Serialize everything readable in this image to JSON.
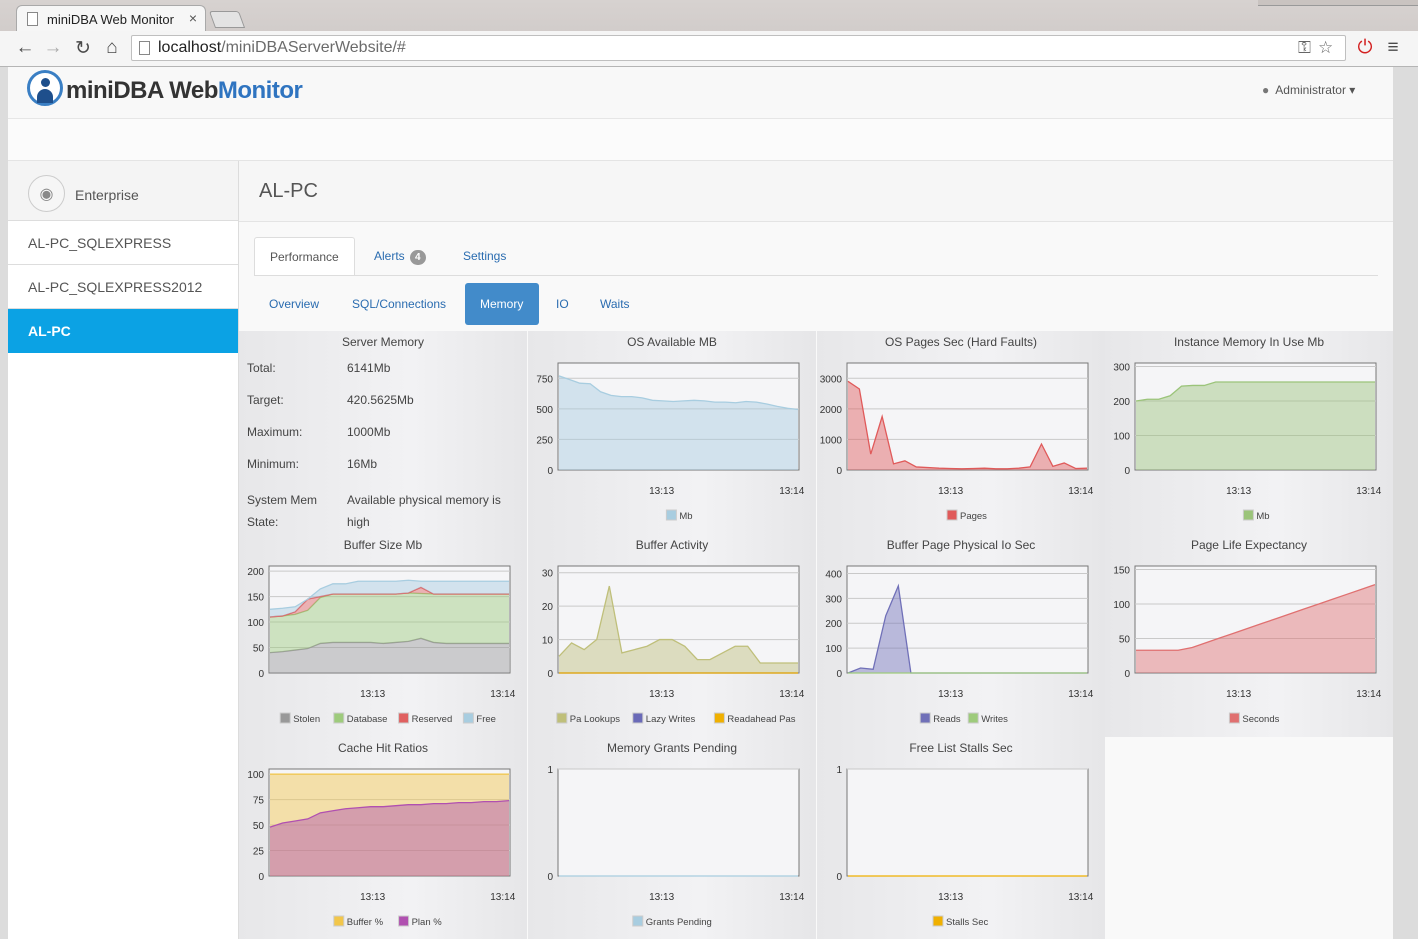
{
  "browser": {
    "tab_title": "miniDBA Web Monitor",
    "url_host": "localhost",
    "url_path": "/miniDBAServerWebsite/#"
  },
  "app": {
    "logo_mini": "mini",
    "logo_dba": "DBA ",
    "logo_web": "Web",
    "logo_monitor": "Monitor",
    "user_menu": "Administrator"
  },
  "sidebar": {
    "group": "Enterprise",
    "items": [
      {
        "label": "AL-PC_SQLEXPRESS",
        "active": false
      },
      {
        "label": "AL-PC_SQLEXPRESS2012",
        "active": false
      },
      {
        "label": "AL-PC",
        "active": true
      }
    ]
  },
  "page": {
    "title": "AL-PC",
    "tabs": [
      {
        "label": "Performance",
        "active": true
      },
      {
        "label": "Alerts",
        "badge": "4",
        "active": false
      },
      {
        "label": "Settings",
        "active": false
      }
    ],
    "subtabs": [
      {
        "label": "Overview",
        "active": false
      },
      {
        "label": "SQL/Connections",
        "active": false
      },
      {
        "label": "Memory",
        "active": true
      },
      {
        "label": "IO",
        "active": false
      },
      {
        "label": "Waits",
        "active": false
      }
    ]
  },
  "server_memory": {
    "title": "Server Memory",
    "rows": [
      {
        "label": "Total:",
        "value": "6141Mb"
      },
      {
        "label": "Target:",
        "value": "420.5625Mb"
      },
      {
        "label": "Maximum:",
        "value": "1000Mb"
      },
      {
        "label": "Minimum:",
        "value": "16Mb"
      },
      {
        "label": "System Mem State:",
        "value": "Available physical memory is high"
      }
    ]
  },
  "chart_data": [
    {
      "id": "os-available-mb",
      "type": "area",
      "title": "OS Available MB",
      "ylim": [
        0,
        875
      ],
      "yticks": [
        0,
        250,
        500,
        750
      ],
      "xticks": [
        "13:13",
        "13:14"
      ],
      "series": [
        {
          "name": "Mb",
          "color": "#a8cde0",
          "values": [
            770,
            740,
            710,
            705,
            640,
            610,
            600,
            600,
            590,
            570,
            565,
            560,
            565,
            570,
            565,
            555,
            555,
            550,
            560,
            555,
            540,
            520,
            505,
            495
          ]
        }
      ]
    },
    {
      "id": "os-pages-sec",
      "type": "area",
      "title": "OS Pages Sec (Hard Faults)",
      "ylim": [
        0,
        3500
      ],
      "yticks": [
        0,
        1000,
        2000,
        3000
      ],
      "xticks": [
        "13:13",
        "13:14"
      ],
      "series": [
        {
          "name": "Pages",
          "color": "#e05a5a",
          "values": [
            2900,
            2650,
            520,
            1750,
            200,
            300,
            100,
            80,
            60,
            50,
            40,
            50,
            60,
            40,
            40,
            60,
            100,
            850,
            120,
            230,
            50,
            60
          ]
        }
      ]
    },
    {
      "id": "instance-memory",
      "type": "area",
      "title": "Instance Memory In Use Mb",
      "ylim": [
        0,
        310
      ],
      "yticks": [
        0,
        100,
        200,
        300
      ],
      "xticks": [
        "13:13",
        "13:14"
      ],
      "series": [
        {
          "name": "Mb",
          "color": "#9bc47a",
          "values": [
            200,
            205,
            205,
            215,
            243,
            245,
            245,
            255,
            255,
            255,
            255,
            255,
            255,
            255,
            255,
            255,
            255,
            255,
            255,
            255,
            255,
            255
          ]
        }
      ]
    },
    {
      "id": "buffer-size",
      "type": "stacked-area",
      "title": "Buffer Size Mb",
      "ylim": [
        0,
        210
      ],
      "yticks": [
        0,
        50,
        100,
        150,
        200
      ],
      "xticks": [
        "13:13",
        "13:14"
      ],
      "series": [
        {
          "name": "Stolen",
          "color": "#999999",
          "values": [
            40,
            42,
            45,
            48,
            58,
            60,
            60,
            60,
            60,
            58,
            60,
            62,
            68,
            60,
            58,
            58,
            58,
            58,
            58,
            58
          ]
        },
        {
          "name": "Database",
          "color": "#9ecb7c",
          "values": [
            70,
            70,
            70,
            75,
            90,
            95,
            95,
            95,
            95,
            97,
            95,
            95,
            88,
            95,
            97,
            97,
            97,
            97,
            97,
            97
          ]
        },
        {
          "name": "Reserved",
          "color": "#e06060",
          "values": [
            0,
            0,
            5,
            22,
            2,
            0,
            0,
            0,
            0,
            0,
            0,
            0,
            12,
            0,
            0,
            0,
            0,
            0,
            0,
            0
          ]
        },
        {
          "name": "Free",
          "color": "#a8cde0",
          "values": [
            15,
            15,
            10,
            0,
            15,
            20,
            20,
            25,
            25,
            25,
            25,
            25,
            12,
            25,
            25,
            25,
            25,
            25,
            25,
            25
          ]
        }
      ]
    },
    {
      "id": "buffer-activity",
      "type": "area",
      "title": "Buffer Activity",
      "ylim": [
        0,
        32
      ],
      "yticks": [
        0,
        10,
        20,
        30
      ],
      "xticks": [
        "13:13",
        "13:14"
      ],
      "series": [
        {
          "name": "Pa Lookups",
          "color": "#bfbf7a",
          "values": [
            5,
            9,
            7,
            10,
            26,
            6,
            7,
            8,
            10,
            10,
            8,
            4,
            4,
            6,
            8,
            8,
            3,
            3,
            3,
            3
          ]
        },
        {
          "name": "Lazy Writes",
          "color": "#6a6ab8",
          "values": [
            0,
            0,
            0,
            0,
            0,
            0,
            0,
            0,
            0,
            0,
            0,
            0,
            0,
            0,
            0,
            0,
            0,
            0,
            0,
            0
          ]
        },
        {
          "name": "Readahead Pas",
          "color": "#f0b000",
          "values": [
            0,
            0,
            0,
            0,
            0,
            0,
            0,
            0,
            0,
            0,
            0,
            0,
            0,
            0,
            0,
            0,
            0,
            0,
            0,
            0
          ]
        }
      ]
    },
    {
      "id": "buffer-page-io",
      "type": "area",
      "title": "Buffer Page Physical Io Sec",
      "ylim": [
        0,
        430
      ],
      "yticks": [
        0,
        100,
        200,
        300,
        400
      ],
      "xticks": [
        "13:13",
        "13:14"
      ],
      "series": [
        {
          "name": "Reads",
          "color": "#7070b8",
          "values": [
            0,
            20,
            15,
            230,
            350,
            0,
            0,
            0,
            0,
            0,
            0,
            0,
            0,
            0,
            0,
            0,
            0,
            0,
            0,
            0
          ]
        },
        {
          "name": "Writes",
          "color": "#9ecb7c",
          "values": [
            0,
            0,
            0,
            0,
            0,
            0,
            0,
            0,
            0,
            0,
            0,
            0,
            0,
            0,
            0,
            0,
            0,
            0,
            0,
            0
          ]
        }
      ]
    },
    {
      "id": "page-life",
      "type": "area",
      "title": "Page Life Expectancy",
      "ylim": [
        0,
        155
      ],
      "yticks": [
        0,
        50,
        100,
        150
      ],
      "xticks": [
        "13:13",
        "13:14"
      ],
      "series": [
        {
          "name": "Seconds",
          "color": "#e07070",
          "values": [
            33,
            33,
            33,
            33,
            37,
            44,
            51,
            58,
            65,
            72,
            79,
            86,
            93,
            100,
            107,
            114,
            121,
            128
          ]
        }
      ]
    },
    {
      "id": "cache-hit",
      "type": "area",
      "title": "Cache Hit Ratios",
      "ylim": [
        0,
        105
      ],
      "yticks": [
        0,
        25,
        50,
        75,
        100
      ],
      "xticks": [
        "13:13",
        "13:14"
      ],
      "series": [
        {
          "name": "Buffer %",
          "color": "#f2c64a",
          "values": [
            100,
            100,
            100,
            100,
            100,
            100,
            100,
            100,
            100,
            100,
            100,
            100,
            100,
            100,
            100,
            100,
            100,
            100,
            100,
            100
          ]
        },
        {
          "name": "Plan %",
          "color": "#b050b0",
          "values": [
            48,
            52,
            54,
            56,
            62,
            64,
            66,
            67,
            68,
            68,
            69,
            70,
            70,
            71,
            71,
            72,
            72,
            73,
            73,
            74
          ]
        }
      ]
    },
    {
      "id": "grants-pending",
      "type": "line",
      "title": "Memory Grants Pending",
      "ylim": [
        0,
        1
      ],
      "yticks": [
        0,
        1
      ],
      "xticks": [
        "13:13",
        "13:14"
      ],
      "series": [
        {
          "name": "Grants Pending",
          "color": "#a8cde0",
          "values": [
            0,
            0,
            0,
            0,
            0,
            0,
            0,
            0,
            0,
            0
          ]
        }
      ]
    },
    {
      "id": "free-list-stalls",
      "type": "line",
      "title": "Free List Stalls Sec",
      "ylim": [
        0,
        1
      ],
      "yticks": [
        0,
        1
      ],
      "xticks": [
        "13:13",
        "13:14"
      ],
      "series": [
        {
          "name": "Stalls Sec",
          "color": "#f0b000",
          "values": [
            0,
            0,
            0,
            0,
            0,
            0,
            0,
            0,
            0,
            0
          ]
        }
      ]
    }
  ]
}
